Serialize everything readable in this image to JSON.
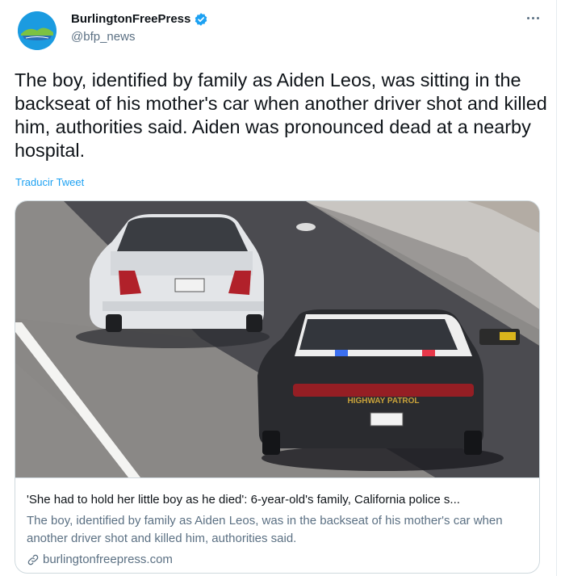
{
  "account": {
    "display_name": "BurlingtonFreePress",
    "handle": "@bfp_news",
    "verified": true,
    "avatar_icon": "burlington-landscape-logo"
  },
  "tweet": {
    "text": "The boy, identified by family as Aiden Leos, was sitting in the backseat of his mother's car when another driver shot and killed him, authorities said. Aiden was pronounced dead at a nearby hospital.",
    "translate_label": "Traducir Tweet"
  },
  "card": {
    "image_alt": "white sedan followed by highway patrol car",
    "patrol_label": "HIGHWAY PATROL",
    "title": "'She had to hold her little boy as he died': 6-year-old's family, California police s...",
    "description": "The boy, identified by family as Aiden Leos, was in the backseat of his mother's car when another driver shot and killed him, authorities said.",
    "domain": "burlingtonfreepress.com"
  },
  "colors": {
    "accent": "#1da1f2",
    "secondary_text": "#5b7083",
    "border": "#cfd9de"
  }
}
